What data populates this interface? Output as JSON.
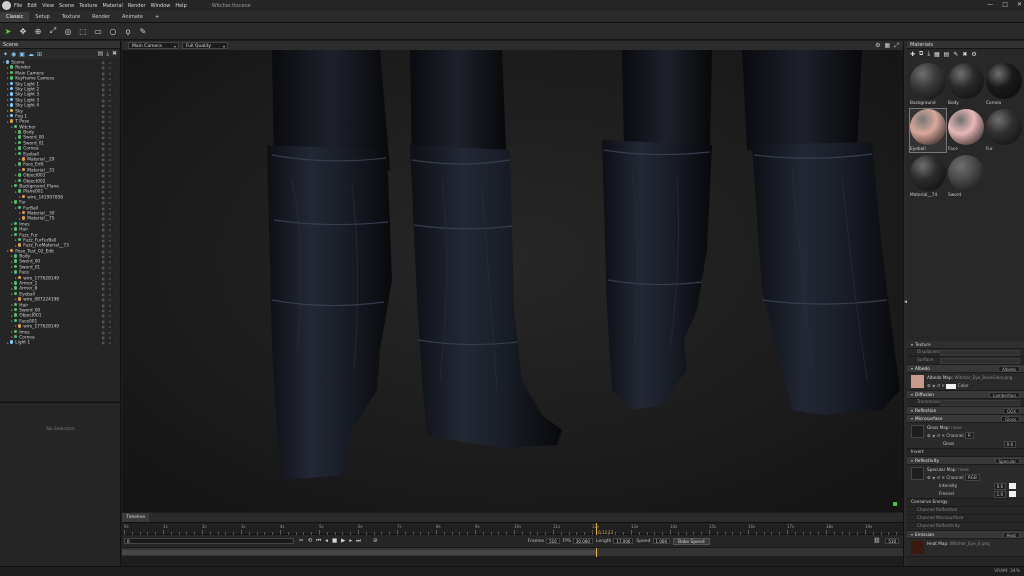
{
  "app": {
    "title": "Witcher.ttscene",
    "menu": [
      "File",
      "Edit",
      "View",
      "Scene",
      "Texture",
      "Material",
      "Render",
      "Window",
      "Help"
    ],
    "window_controls": [
      "—",
      "□",
      "✕"
    ]
  },
  "tabs": [
    "Classic",
    "Setup",
    "Texture",
    "Render",
    "Animate",
    "+"
  ],
  "toolbar": {
    "tools": [
      "pointer-tool",
      "move-tool",
      "rotate-tool",
      "scale-tool",
      "focus-tool",
      "select-tool",
      "box-select-tool",
      "circle-select-tool",
      "lasso-tool",
      "paint-tool"
    ]
  },
  "scene": {
    "panel_title": "Scene",
    "no_selection": "No Selection",
    "tree": [
      {
        "label": "Scene",
        "depth": 0,
        "color": "#8ab4e0"
      },
      {
        "label": "Render",
        "depth": 1,
        "color": "#4fc06a"
      },
      {
        "label": "Main Camera",
        "depth": 1,
        "color": "#4fc06a"
      },
      {
        "label": "Keyframe Camera",
        "depth": 1,
        "color": "#4fc06a"
      },
      {
        "label": "Sky Light 1",
        "depth": 1,
        "color": "#7ccfff"
      },
      {
        "label": "Sky Light 2",
        "depth": 1,
        "color": "#7ccfff"
      },
      {
        "label": "Sky Light 3",
        "depth": 1,
        "color": "#7ccfff"
      },
      {
        "label": "Sky Light 3",
        "depth": 1,
        "color": "#7ccfff"
      },
      {
        "label": "Sky Light 4",
        "depth": 1,
        "color": "#7ccfff"
      },
      {
        "label": "Sky",
        "depth": 1,
        "color": "#f0c040"
      },
      {
        "label": "Fog 1",
        "depth": 1,
        "color": "#7ccfff"
      },
      {
        "label": "T Pose",
        "depth": 1,
        "color": "#e0a040"
      },
      {
        "label": "Witcher",
        "depth": 2,
        "color": "#4fc06a"
      },
      {
        "label": "Body",
        "depth": 3,
        "color": "#4fc06a"
      },
      {
        "label": "Sword_00",
        "depth": 3,
        "color": "#4fc06a"
      },
      {
        "label": "Sword_01",
        "depth": 3,
        "color": "#4fc06a"
      },
      {
        "label": "Cornea",
        "depth": 3,
        "color": "#4fc06a"
      },
      {
        "label": "Eyeball",
        "depth": 3,
        "color": "#4fc06a"
      },
      {
        "label": "Material__29",
        "depth": 4,
        "color": "#e0a040"
      },
      {
        "label": "Face_Edit",
        "depth": 3,
        "color": "#4fc06a"
      },
      {
        "label": "Material__31",
        "depth": 4,
        "color": "#e0a040"
      },
      {
        "label": "Object001",
        "depth": 3,
        "color": "#4fc06a"
      },
      {
        "label": "Object002",
        "depth": 3,
        "color": "#4fc06a"
      },
      {
        "label": "Background_Plane",
        "depth": 2,
        "color": "#4fc06a"
      },
      {
        "label": "Plane001",
        "depth": 3,
        "color": "#4fc06a"
      },
      {
        "label": "wire_141907858",
        "depth": 4,
        "color": "#e0a040"
      },
      {
        "label": "Fur",
        "depth": 2,
        "color": "#4fc06a"
      },
      {
        "label": "FurBall",
        "depth": 3,
        "color": "#4fc06a"
      },
      {
        "label": "Material__30",
        "depth": 4,
        "color": "#e0a040"
      },
      {
        "label": "Material__75",
        "depth": 4,
        "color": "#e0a040"
      },
      {
        "label": "Imes",
        "depth": 2,
        "color": "#4fc06a"
      },
      {
        "label": "Hair",
        "depth": 2,
        "color": "#4fc06a"
      },
      {
        "label": "Fuzz_Fur",
        "depth": 2,
        "color": "#4fc06a"
      },
      {
        "label": "Fuzz_FurFurBall",
        "depth": 3,
        "color": "#4fc06a"
      },
      {
        "label": "Fuzz_FurMaterial__73",
        "depth": 3,
        "color": "#e0a040"
      },
      {
        "label": "Pose_Test_02_Edit",
        "depth": 1,
        "color": "#e0a040"
      },
      {
        "label": "Body",
        "depth": 2,
        "color": "#4fc06a"
      },
      {
        "label": "Sword_00",
        "depth": 2,
        "color": "#4fc06a"
      },
      {
        "label": "Sword_01",
        "depth": 2,
        "color": "#4fc06a"
      },
      {
        "label": "Face",
        "depth": 2,
        "color": "#4fc06a"
      },
      {
        "label": "wire_177628149",
        "depth": 3,
        "color": "#e0a040"
      },
      {
        "label": "Armor_1",
        "depth": 2,
        "color": "#4fc06a"
      },
      {
        "label": "Armor_8",
        "depth": 2,
        "color": "#4fc06a"
      },
      {
        "label": "Eyeball",
        "depth": 2,
        "color": "#4fc06a"
      },
      {
        "label": "wire_087224198",
        "depth": 3,
        "color": "#e0a040"
      },
      {
        "label": "Hair",
        "depth": 2,
        "color": "#4fc06a"
      },
      {
        "label": "Sword_00",
        "depth": 2,
        "color": "#4fc06a"
      },
      {
        "label": "Object001",
        "depth": 2,
        "color": "#4fc06a"
      },
      {
        "label": "Face001",
        "depth": 2,
        "color": "#4fc06a"
      },
      {
        "label": "wire_177628149",
        "depth": 3,
        "color": "#e0a040"
      },
      {
        "label": "Imes",
        "depth": 2,
        "color": "#4fc06a"
      },
      {
        "label": "Cornea",
        "depth": 2,
        "color": "#4fc06a"
      },
      {
        "label": "Light 1",
        "depth": 1,
        "color": "#7ccfff"
      }
    ]
  },
  "viewport": {
    "camera": "Main Camera",
    "quality": "Full Quality"
  },
  "timeline": {
    "tab": "Timeline",
    "ticks": [
      "0s",
      "1s",
      "2s",
      "3s",
      "4s",
      "5s",
      "6s",
      "7s",
      "8s",
      "9s",
      "10s",
      "11s",
      "12s",
      "13s",
      "14s",
      "15s",
      "16s",
      "17s",
      "18s",
      "19s"
    ],
    "current_time": "0:12.12",
    "current_fraction": 0.637,
    "frame_field": "0",
    "frames_label": "Frames",
    "frames_value": "510",
    "fps_label": "FPS",
    "fps_value": "30.000",
    "length_label": "Length",
    "length_value": "17.000",
    "speed_label": "Speed",
    "speed_value": "1.000",
    "bake_label": "Bake Speed",
    "end_value": "510"
  },
  "status": {
    "vram": "VRAM: 34%"
  },
  "materials": {
    "panel_title": "Materials",
    "swatches": [
      {
        "name": "Background",
        "color": "#3a3a3a"
      },
      {
        "name": "Body",
        "color": "#2a2a2a"
      },
      {
        "name": "Cornea",
        "color": "#1a1a1a"
      },
      {
        "name": "Eyeball",
        "color": "#d8a89a"
      },
      {
        "name": "Face",
        "color": "#e8b8b8"
      },
      {
        "name": "Fur",
        "color": "#303030"
      },
      {
        "name": "Material__74",
        "color": "#2c2c2c"
      },
      {
        "name": "Sword",
        "color": "#4a4a4a"
      }
    ],
    "selected": "Eyeball"
  },
  "properties": {
    "texture_label": "Texture",
    "displacement_label": "Displacement",
    "surface_label": "Surface",
    "albedo_label": "Albedo",
    "albedo_mode": "Albedo",
    "albedo_map_label": "Albedo Map",
    "albedo_map_file": "Witcher_Eye_BaseColor.png",
    "color_label": "Color",
    "diffusion_label": "Diffusion",
    "diffusion_mode": "Lambertian",
    "transmission_label": "Transmission",
    "reflection_label": "Reflection",
    "reflection_mode": "GGX",
    "microsurface_label": "Microsurface",
    "microsurface_mode": "Gloss",
    "gloss_map_label": "Gloss Map",
    "gloss_map_file": "none",
    "channel_label": "Channel",
    "gloss_channel": "R",
    "gloss_label": "Gloss",
    "gloss_value": "0.6",
    "invert_label": "Invert",
    "reflectivity_label": "Reflectivity",
    "reflectivity_mode": "Specular",
    "specular_map_label": "Specular Map",
    "specular_map_file": "none",
    "specular_channel": "RGB",
    "intensity_label": "Intensity",
    "intensity_value": "0.6",
    "fresnel_label": "Fresnel",
    "fresnel_value": "1.0",
    "conserve_label": "Conserve Energy",
    "channel_reflect_label": "Channel Reflection",
    "channel_micro_label": "Channel Microsurface",
    "channel_refl2_label": "Channel Reflectivity",
    "emission_label": "Emission",
    "emission_mode": "Heat",
    "heat_map_label": "Heat Map",
    "heat_map_file": "Witcher_Eye_E.png"
  }
}
